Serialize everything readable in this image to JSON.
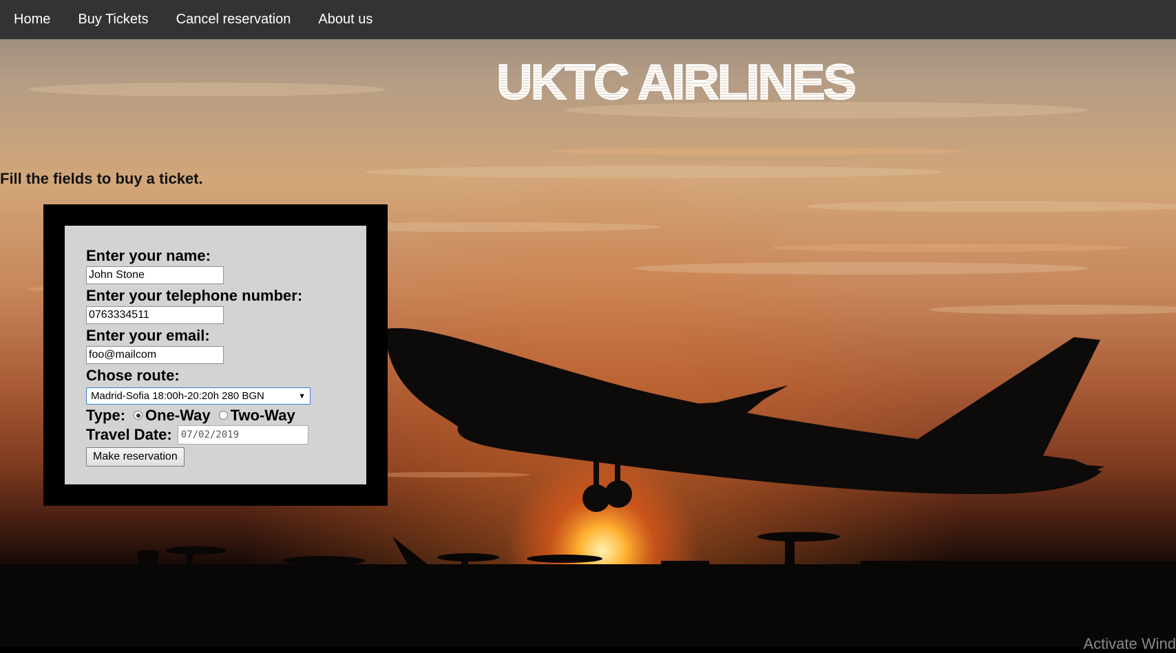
{
  "nav": {
    "items": [
      {
        "label": "Home"
      },
      {
        "label": "Buy Tickets"
      },
      {
        "label": "Cancel reservation"
      },
      {
        "label": "About us"
      }
    ]
  },
  "header": {
    "logo_text": "UKTC AIRLINES"
  },
  "intro": {
    "text": "Fill the fields to buy a ticket."
  },
  "form": {
    "name_label": "Enter your name:",
    "name_value": "John Stone",
    "phone_label": "Enter your telephone number:",
    "phone_value": "0763334511",
    "email_label": "Enter your email:",
    "email_value": "foo@mailcom",
    "route_label": "Chose route:",
    "route_selected": "Madrid-Sofia 18:00h-20:20h 280 BGN",
    "type_label": "Type:",
    "type_options": [
      {
        "label": "One-Way",
        "checked": true
      },
      {
        "label": "Two-Way",
        "checked": false
      }
    ],
    "date_label": "Travel Date:",
    "date_value": "07/02/2019",
    "submit_label": "Make reservation"
  },
  "watermark": {
    "text": "Activate Wind"
  },
  "colors": {
    "navbar": "#333333",
    "form_frame": "#000000",
    "form_panel": "#d3d3d3"
  }
}
